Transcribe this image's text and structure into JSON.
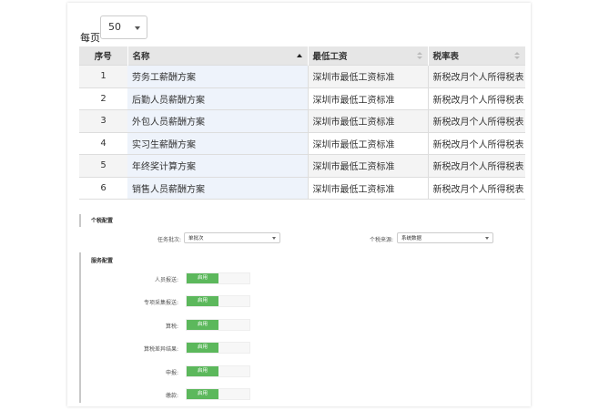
{
  "pagination": {
    "per_page_label": "每页",
    "per_page_value": "50"
  },
  "table": {
    "headers": [
      "序号",
      "名称",
      "最低工资",
      "税率表"
    ],
    "rows": [
      [
        "1",
        "劳务工薪酬方案",
        "深圳市最低工资标准",
        "新税改月个人所得税表"
      ],
      [
        "2",
        "后勤人员薪酬方案",
        "深圳市最低工资标准",
        "新税改月个人所得税表"
      ],
      [
        "3",
        "外包人员薪酬方案",
        "深圳市最低工资标准",
        "新税改月个人所得税表"
      ],
      [
        "4",
        "实习生薪酬方案",
        "深圳市最低工资标准",
        "新税改月个人所得税表"
      ],
      [
        "5",
        "年终奖计算方案",
        "深圳市最低工资标准",
        "新税改月个人所得税表"
      ],
      [
        "6",
        "销售人员薪酬方案",
        "深圳市最低工资标准",
        "新税改月个人所得税表"
      ]
    ]
  },
  "tax_config": {
    "title": "个税配置",
    "batch_label": "任务批次:",
    "batch_value": "单批次",
    "source_label": "个税来源:",
    "source_value": "系统数据"
  },
  "service_config": {
    "title": "服务配置",
    "items": [
      {
        "label": "人员报送:",
        "state": "启用"
      },
      {
        "label": "专项采集报送:",
        "state": "启用"
      },
      {
        "label": "算税:",
        "state": "启用"
      },
      {
        "label": "算税差异结果:",
        "state": "启用"
      },
      {
        "label": "申报:",
        "state": "启用"
      },
      {
        "label": "缴款:",
        "state": "启用"
      }
    ]
  },
  "colors": {
    "toggle_on": "#5cb85c",
    "header_bg": "#e6e6e6",
    "highlight_col": "#eef3fb"
  }
}
